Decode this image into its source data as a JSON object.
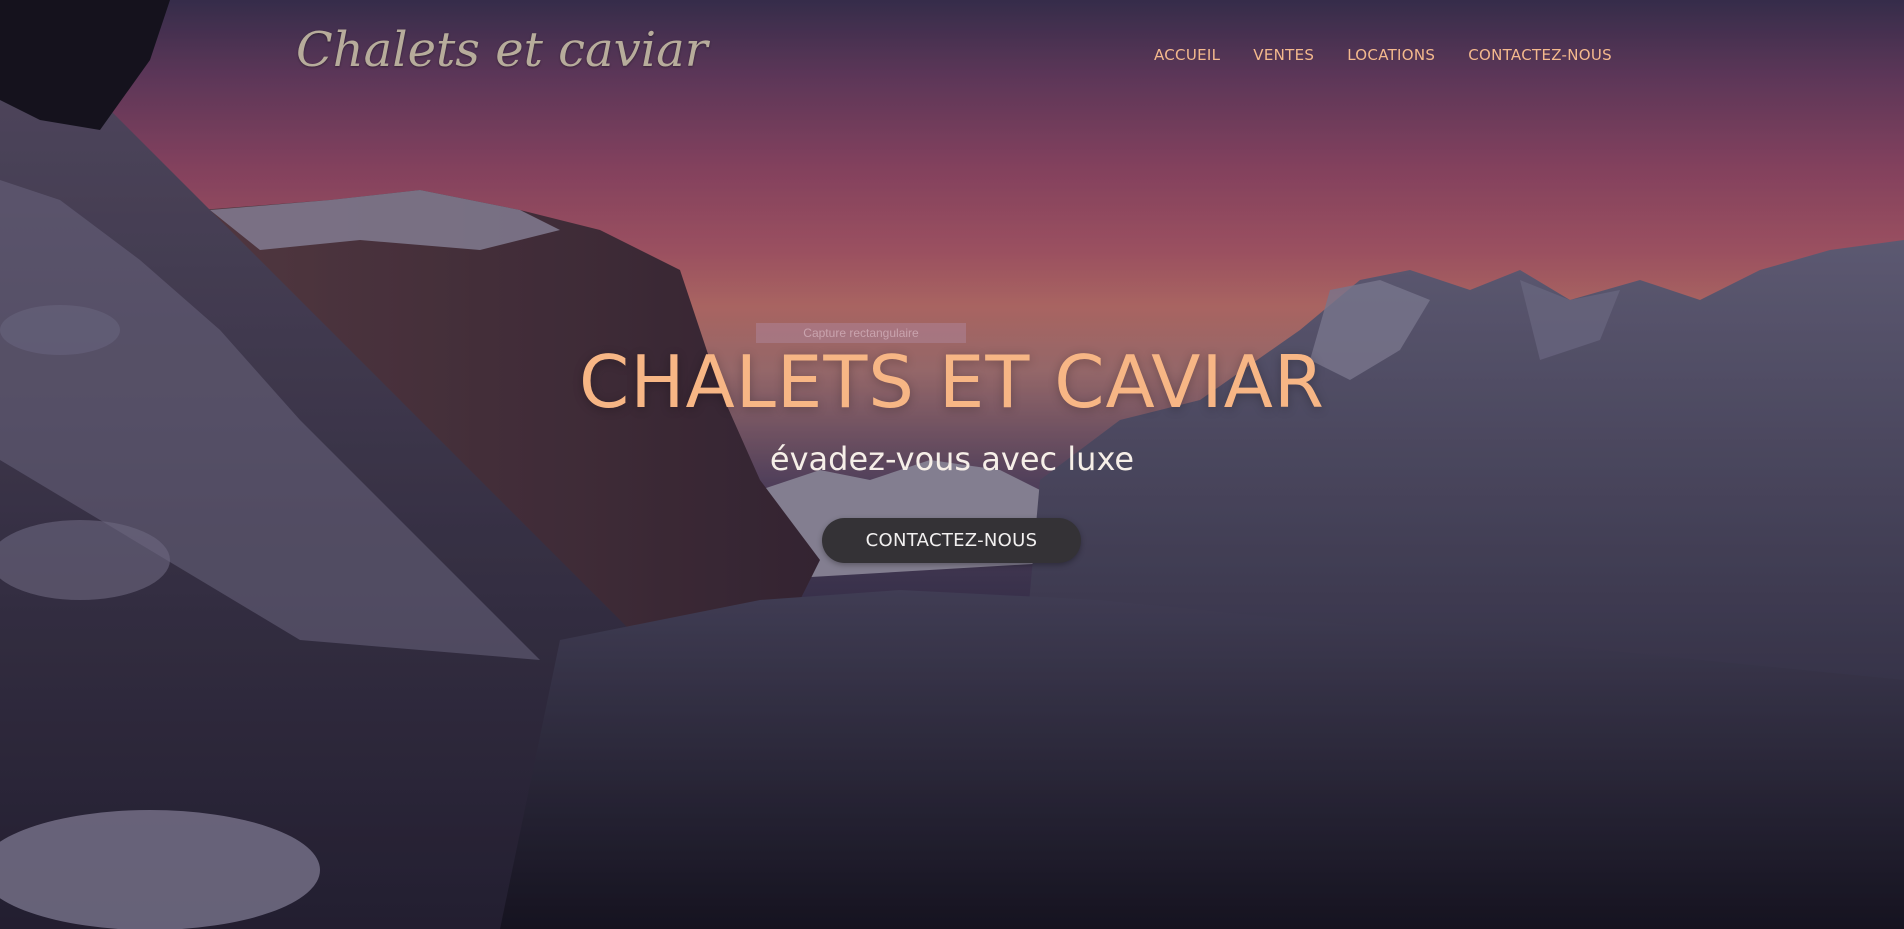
{
  "header": {
    "logo_text": "Chalets et caviar",
    "nav": [
      {
        "label": "ACCUEIL"
      },
      {
        "label": "VENTES"
      },
      {
        "label": "LOCATIONS"
      },
      {
        "label": "CONTACTEZ-NOUS"
      }
    ]
  },
  "hero": {
    "overlay_tooltip": "Capture rectangulaire",
    "title": "CHALETS ET CAVIAR",
    "subtitle": "évadez-vous avec luxe",
    "cta_label": "CONTACTEZ-NOUS"
  },
  "colors": {
    "accent": "#f7b685",
    "nav_text": "#f4b98d",
    "logo": "#b7ac9b",
    "button_bg": "#343236",
    "subtitle": "#f6efe8"
  }
}
